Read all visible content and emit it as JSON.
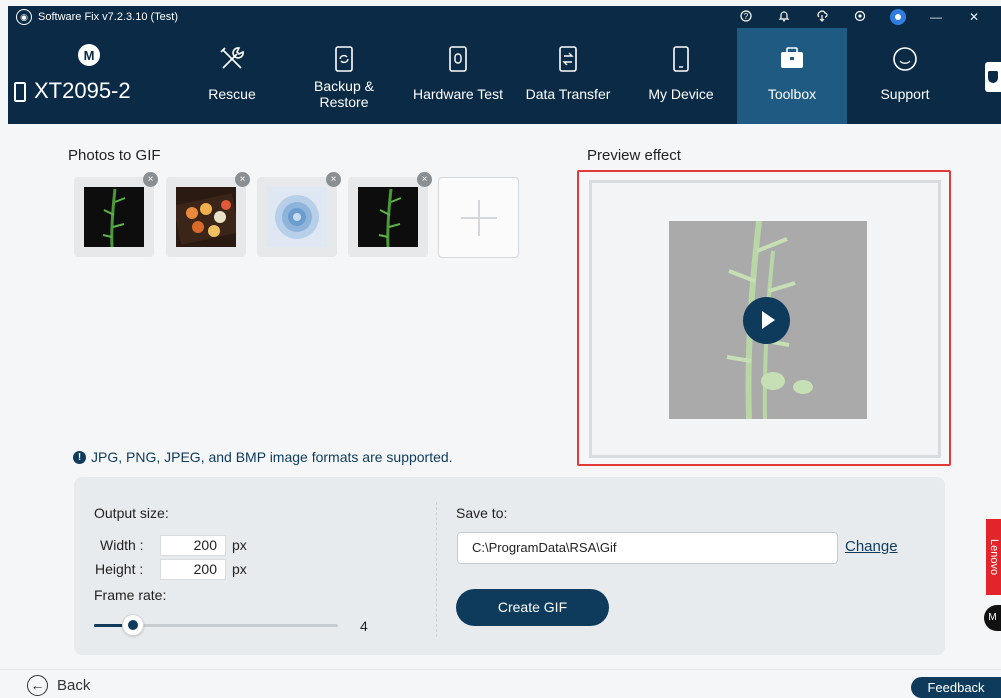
{
  "titlebar": {
    "title": "Software Fix v7.2.3.10 (Test)",
    "icons": [
      "help-icon",
      "bell-icon",
      "download-icon",
      "settings-icon",
      "user-icon",
      "minimize-icon",
      "close-icon"
    ],
    "minimize": "—",
    "close": "✕"
  },
  "brand": {
    "logo": "M",
    "device_name": "XT2095-2"
  },
  "tabs": [
    {
      "label": "Rescue",
      "icon": "wrench-icon"
    },
    {
      "label": "Backup & Restore",
      "line1": "Backup &",
      "line2": "Restore",
      "icon": "backup-icon"
    },
    {
      "label": "Hardware Test",
      "icon": "hardware-test-icon"
    },
    {
      "label": "Data Transfer",
      "icon": "data-transfer-icon"
    },
    {
      "label": "My Device",
      "icon": "phone-icon"
    },
    {
      "label": "Toolbox",
      "icon": "toolbox-icon",
      "active": true
    },
    {
      "label": "Support",
      "icon": "chat-icon"
    }
  ],
  "photos": {
    "title": "Photos to GIF",
    "items": [
      {
        "name": "bamboo-1"
      },
      {
        "name": "sushi"
      },
      {
        "name": "rose"
      },
      {
        "name": "bamboo-2"
      }
    ],
    "remove_glyph": "×"
  },
  "preview": {
    "title": "Preview effect"
  },
  "info": {
    "icon_glyph": "!",
    "text": "JPG, PNG, JPEG, and BMP image formats are supported."
  },
  "output": {
    "size_label": "Output size:",
    "width_label": "Width :",
    "width_value": "200",
    "height_label": "Height :",
    "height_value": "200",
    "unit": "px",
    "frame_rate_label": "Frame rate:",
    "frame_rate_value": "4",
    "frame_rate_fraction": 0.16
  },
  "save": {
    "label": "Save to:",
    "path": "C:\\ProgramData\\RSA\\Gif",
    "change": "Change",
    "create_button": "Create GIF"
  },
  "footer": {
    "back": "Back",
    "back_glyph": "←",
    "feedback": "Feedback",
    "lenovo": "Lenovo",
    "moto_glyph": "M"
  },
  "colors": {
    "navy": "#0b2a45",
    "accent": "#0e3b5c",
    "active_tab": "#1f5a82",
    "highlight_border": "#e23a3a",
    "lenovo_red": "#e1252b"
  }
}
